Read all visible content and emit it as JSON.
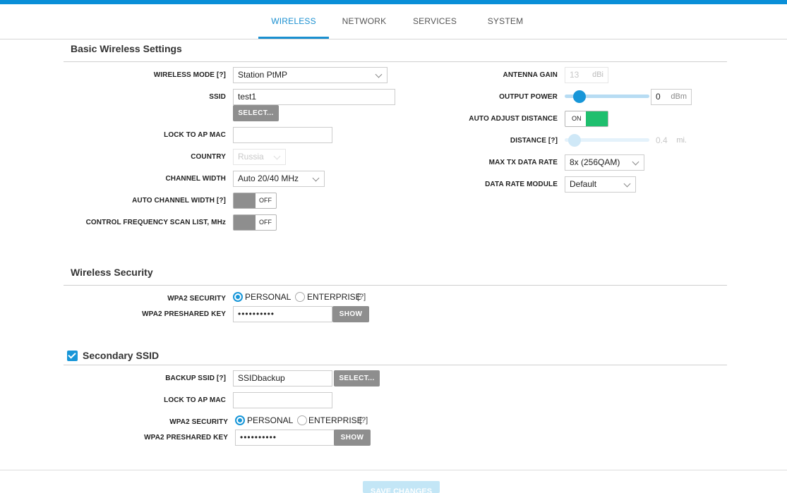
{
  "tabs": [
    "WIRELESS",
    "NETWORK",
    "SERVICES",
    "SYSTEM"
  ],
  "colors": {
    "accent": "#1796d8",
    "toggle_on": "#1fbf6e",
    "toggle_off": "#8e8e8e",
    "topbar": "#0a8fd8"
  },
  "basic": {
    "title": "Basic Wireless Settings",
    "wireless_mode_label": "WIRELESS MODE [?]",
    "wireless_mode_value": "Station PtMP",
    "ssid_label": "SSID",
    "ssid_value": "test1",
    "select_label": "SELECT...",
    "lock_ap_label": "LOCK TO AP MAC",
    "lock_ap_value": "",
    "country_label": "COUNTRY",
    "country_value": "Russia",
    "channel_width_label": "CHANNEL WIDTH",
    "channel_width_value": "Auto 20/40 MHz",
    "auto_channel_label": "AUTO CHANNEL WIDTH [?]",
    "auto_channel_state": "OFF",
    "scan_list_label": "CONTROL FREQUENCY SCAN LIST, MHz",
    "scan_list_state": "OFF",
    "antenna_gain_label": "ANTENNA GAIN",
    "antenna_gain_value": "13",
    "antenna_gain_unit": "dBi",
    "output_power_label": "OUTPUT POWER",
    "output_power_value": "0",
    "output_power_unit": "dBm",
    "output_power_level": 0.12,
    "auto_adjust_label": "AUTO ADJUST DISTANCE",
    "auto_adjust_state": "ON",
    "distance_label": "DISTANCE [?]",
    "distance_value": "0.4",
    "distance_unit": "mi.",
    "distance_level": 0.05,
    "max_tx_label": "MAX TX DATA RATE",
    "max_tx_value": "8x (256QAM)",
    "data_rate_module_label": "DATA RATE MODULE",
    "data_rate_module_value": "Default"
  },
  "security": {
    "title": "Wireless Security",
    "wpa2_label": "WPA2 SECURITY",
    "personal_label": "PERSONAL",
    "enterprise_label": "ENTERPRISE",
    "help": "[?]",
    "key_label": "WPA2 PRESHARED KEY",
    "key_value": "••••••••••",
    "show_label": "SHOW"
  },
  "secondary": {
    "title": "Secondary SSID",
    "checked": true,
    "backup_ssid_label": "BACKUP SSID [?]",
    "backup_ssid_value": "SSIDbackup",
    "select_label": "SELECT...",
    "lock_ap_label": "LOCK TO AP MAC",
    "lock_ap_value": "",
    "wpa2_label": "WPA2 SECURITY",
    "personal_label": "PERSONAL",
    "enterprise_label": "ENTERPRISE",
    "help": "[?]",
    "key_label": "WPA2 PRESHARED KEY",
    "key_value": "••••••••••",
    "show_label": "SHOW"
  },
  "footer": {
    "save_label": "SAVE CHANGES"
  }
}
